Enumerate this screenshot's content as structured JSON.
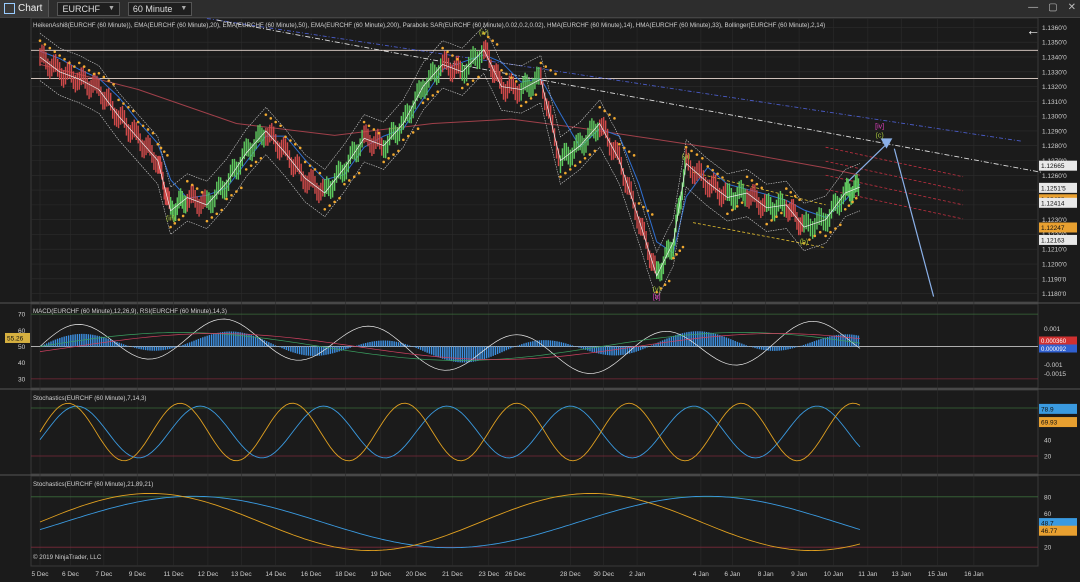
{
  "toolbar": {
    "chart_label": "Chart",
    "instrument": "EURCHF",
    "interval": "60 Minute"
  },
  "panels": {
    "price_header": "HeikenAshi8(EURCHF (60 Minute)), EMA(EURCHF (60 Minute),20), EMA(EURCHF (60 Minute),50), EMA(EURCHF (60 Minute),200), Parabolic SAR(EURCHF (60 Minute),0.02,0.2,0.02), HMA(EURCHF (60 Minute),14), HMA(EURCHF (60 Minute),33), Bollinger(EURCHF (60 Minute),2,14)",
    "macd_header": "MACD(EURCHF (60 Minute),12,26,9), RSI(EURCHF (60 Minute),14,3)",
    "stoch1_header": "Stochastics(EURCHF (60 Minute),7,14,3)",
    "stoch2_header": "Stochastics(EURCHF (60 Minute),21,89,21)",
    "copyright": "© 2019 NinjaTrader, LLC"
  },
  "colors": {
    "background": "#1b1b1b",
    "grid": "#2c2c2c",
    "sar": "#f0a830",
    "ema20": "#2f6fd0",
    "ema200": "#a0404a",
    "bollinger": "#cfcfcf",
    "hma_green": "#5ec85e",
    "hma_red": "#d04a4a",
    "wave_label": "#a8c83a",
    "wave_label_pink": "#e040c0",
    "macd_hist": "#3c8fe0",
    "signal_pink": "#d04060",
    "stoch_k": "#e0a020",
    "stoch_d": "#3a9ae0",
    "price_tag_white": "#e8e8e8",
    "price_tag_orange": "#e8a030",
    "macd_tag_red": "#d03030",
    "macd_tag_blue": "#3060d0",
    "rsi_tag": "#d6b040"
  },
  "chart_data": [
    {
      "type": "line",
      "panel": "price",
      "title": "",
      "ylim": [
        1.1175,
        1.1365
      ],
      "yticks": [
        "1.1360'0",
        "1.1350'0",
        "1.1340'0",
        "1.1330'0",
        "1.1320'0",
        "1.1310'0",
        "1.1300'0",
        "1.1290'0",
        "1.1280'0",
        "1.1270'0",
        "1.1260'0",
        "1.1250'0",
        "1.1240'0",
        "1.1230'0",
        "1.1220'0",
        "1.1210'0",
        "1.1200'0",
        "1.1190'0",
        "1.1180'0"
      ],
      "price_tags": [
        {
          "label": "1.12665",
          "value": 1.12665,
          "style": "white"
        },
        {
          "label": "1.1251'5",
          "value": 1.12515,
          "style": "white"
        },
        {
          "label": "1.12438",
          "value": 1.12438,
          "style": "orange"
        },
        {
          "label": "1.12414",
          "value": 1.12414,
          "style": "white"
        },
        {
          "label": "1.12247",
          "value": 1.12247,
          "style": "orange"
        },
        {
          "label": "1.12163",
          "value": 1.12163,
          "style": "white"
        }
      ],
      "horizontal_lines": [
        1.13445,
        1.13255
      ],
      "wave_labels": [
        {
          "text": "(iv)",
          "t": 0.452,
          "y": 1.1355
        },
        {
          "text": "(iii)",
          "t": 0.133,
          "y": 1.12295
        },
        {
          "text": "(a)",
          "t": 0.658,
          "y": 1.12715
        },
        {
          "text": "(b)",
          "t": 0.778,
          "y": 1.12135
        },
        {
          "text": "(v)",
          "t": 0.628,
          "y": 1.11815
        },
        {
          "text": "[a]",
          "t": 0.628,
          "y": 1.11765,
          "color": "pink"
        },
        {
          "text": "[iv]",
          "t": 0.855,
          "y": 1.12915,
          "color": "pink"
        },
        {
          "text": "(c)",
          "t": 0.855,
          "y": 1.12855
        }
      ],
      "price_series": [
        [
          0,
          1.134
        ],
        [
          0.02,
          1.133
        ],
        [
          0.04,
          1.1325
        ],
        [
          0.06,
          1.1318
        ],
        [
          0.08,
          1.13
        ],
        [
          0.1,
          1.1285
        ],
        [
          0.12,
          1.127
        ],
        [
          0.133,
          1.1236
        ],
        [
          0.15,
          1.1245
        ],
        [
          0.17,
          1.124
        ],
        [
          0.19,
          1.1255
        ],
        [
          0.21,
          1.1275
        ],
        [
          0.23,
          1.129
        ],
        [
          0.25,
          1.1275
        ],
        [
          0.27,
          1.1258
        ],
        [
          0.29,
          1.1248
        ],
        [
          0.31,
          1.1265
        ],
        [
          0.33,
          1.1285
        ],
        [
          0.35,
          1.128
        ],
        [
          0.37,
          1.1295
        ],
        [
          0.39,
          1.132
        ],
        [
          0.41,
          1.1335
        ],
        [
          0.43,
          1.133
        ],
        [
          0.452,
          1.1345
        ],
        [
          0.47,
          1.132
        ],
        [
          0.49,
          1.1318
        ],
        [
          0.51,
          1.1325
        ],
        [
          0.53,
          1.127
        ],
        [
          0.55,
          1.128
        ],
        [
          0.57,
          1.1295
        ],
        [
          0.59,
          1.127
        ],
        [
          0.61,
          1.123
        ],
        [
          0.628,
          1.1192
        ],
        [
          0.645,
          1.1215
        ],
        [
          0.658,
          1.1268
        ],
        [
          0.68,
          1.1255
        ],
        [
          0.7,
          1.1245
        ],
        [
          0.72,
          1.1248
        ],
        [
          0.74,
          1.1238
        ],
        [
          0.76,
          1.124
        ],
        [
          0.778,
          1.1225
        ],
        [
          0.8,
          1.123
        ],
        [
          0.82,
          1.1248
        ],
        [
          0.835,
          1.1252
        ]
      ]
    },
    {
      "type": "bar",
      "panel": "macd_rsi",
      "yticks_left": [
        "70",
        "60",
        "50",
        "40",
        "30"
      ],
      "yticks_right": [
        "0.001",
        "0",
        "-0.001",
        "-0.0015"
      ],
      "rsi_value": "55.26",
      "macd_tags": [
        "0.000360",
        "0.000092"
      ]
    },
    {
      "type": "line",
      "panel": "stochastics_fast",
      "yticks": [
        "80",
        "60",
        "40",
        "20"
      ],
      "value_tags": [
        "78.9",
        "69.93"
      ]
    },
    {
      "type": "line",
      "panel": "stochastics_slow",
      "yticks": [
        "80",
        "60",
        "40",
        "20"
      ],
      "value_tags": [
        "48.7",
        "46.77"
      ]
    }
  ],
  "xaxis": {
    "labels": [
      "5 Dec",
      "6 Dec",
      "7 Dec",
      "9 Dec",
      "11 Dec",
      "12 Dec",
      "13 Dec",
      "14 Dec",
      "16 Dec",
      "18 Dec",
      "19 Dec",
      "20 Dec",
      "21 Dec",
      "23 Dec",
      "26 Dec",
      "28 Dec",
      "30 Dec",
      "2 Jan",
      "4 Jan",
      "6 Jan",
      "8 Jan",
      "9 Jan",
      "10 Jan",
      "11 Jan",
      "13 Jan",
      "15 Jan",
      "16 Jan"
    ],
    "positions": [
      0.0,
      0.031,
      0.065,
      0.099,
      0.136,
      0.171,
      0.205,
      0.24,
      0.276,
      0.311,
      0.347,
      0.383,
      0.42,
      0.457,
      0.484,
      0.54,
      0.574,
      0.608,
      0.673,
      0.705,
      0.739,
      0.773,
      0.808,
      0.843,
      0.877,
      0.914,
      0.951
    ]
  }
}
